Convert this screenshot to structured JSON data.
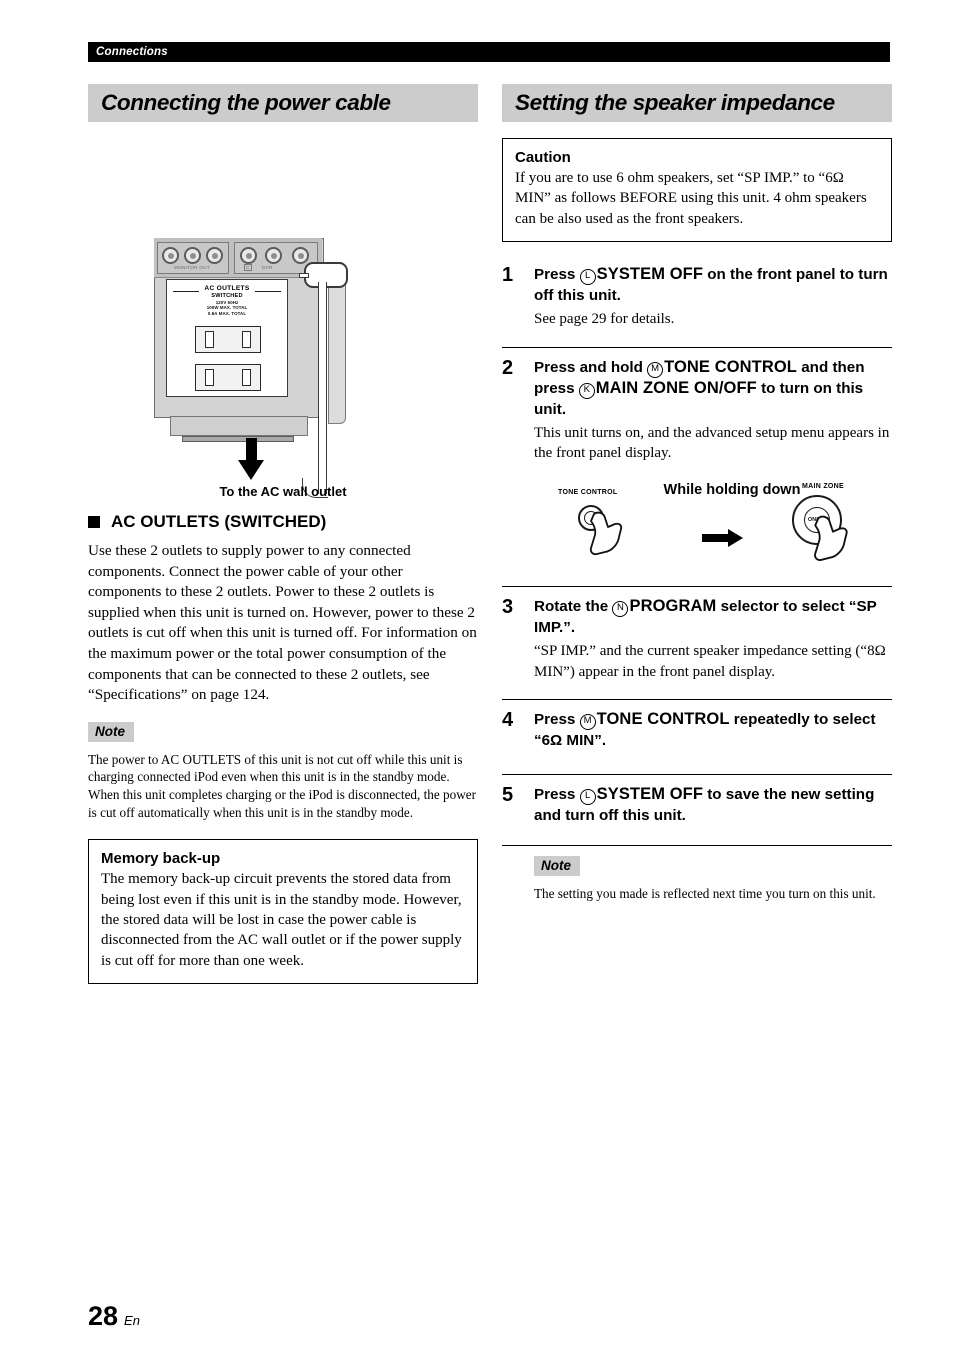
{
  "running_head": "Connections",
  "page": {
    "number": "28",
    "lang": "En"
  },
  "left_column": {
    "section_title": "Connecting the power cable",
    "illustration": {
      "jack_label_monitor": "MONITOR OUT",
      "jack_label_dvr": "DVR",
      "jack_label_c": "C",
      "ac_outlets_title": "AC OUTLETS",
      "ac_outlets_sub": "SWITCHED",
      "ac_outlets_spec1": "120V 60Hz",
      "ac_outlets_spec2": "100W MAX. TOTAL",
      "ac_outlets_spec3": "0.8A MAX. TOTAL",
      "caption": "To the AC wall outlet"
    },
    "subsection": {
      "heading": "AC OUTLETS (SWITCHED)",
      "body": "Use these 2 outlets to supply power to any connected components. Connect the power cable of your other components to these 2 outlets. Power to these 2 outlets is supplied when this unit is turned on. However, power to these 2 outlets is cut off when this unit is turned off. For information on the maximum power or the total power consumption of the components that can be connected to these 2 outlets, see “Specifications” on page 124."
    },
    "note": {
      "tag": "Note",
      "body": "The power to AC OUTLETS of this unit is not cut off while this unit is charging connected iPod even when this unit is in the standby mode. When this unit completes charging or the iPod is disconnected, the power is cut off automatically when this unit is in the standby mode."
    },
    "memory_box": {
      "heading": "Memory back-up",
      "body": "The memory back-up circuit prevents the stored data from being lost even if this unit is in the standby mode. However, the stored data will be lost in case the power cable is disconnected from the AC wall outlet or if the power supply is cut off for more than one week."
    }
  },
  "right_column": {
    "section_title": "Setting the speaker impedance",
    "caution": {
      "heading": "Caution",
      "body": "If you are to use 6 ohm speakers, set “SP IMP.” to “6Ω MIN” as follows BEFORE using this unit. 4 ohm speakers can be also used as the front speakers."
    },
    "steps": [
      {
        "num": "1",
        "title_pre": "Press ",
        "key_letter": "L",
        "key_label": "SYSTEM OFF",
        "title_post": " on the front panel to turn off this unit.",
        "desc": "See page 29 for details."
      },
      {
        "num": "2",
        "title_pre": "Press and hold ",
        "key_letter": "M",
        "key_label": "TONE CONTROL",
        "title_mid": " and then press ",
        "key_letter2": "K",
        "key_label2": "MAIN ZONE ON/OFF",
        "title_post": " to turn on this unit.",
        "desc": "This unit turns on, and the advanced setup menu appears in the front panel display."
      },
      {
        "num": "3",
        "title_pre": "Rotate the ",
        "key_letter": "N",
        "key_label": "PROGRAM",
        "title_post": " selector to select “SP IMP.”.",
        "desc": "“SP IMP.” and the current speaker impedance setting (“8Ω MIN”) appear in the front panel display."
      },
      {
        "num": "4",
        "title_pre": "Press ",
        "key_letter": "M",
        "key_label": "TONE CONTROL",
        "title_post": " repeatedly to select “6Ω MIN”.",
        "desc": ""
      },
      {
        "num": "5",
        "title_pre": "Press ",
        "key_letter": "L",
        "key_label": "SYSTEM OFF",
        "title_post": " to save the new setting and turn off this unit.",
        "desc": ""
      }
    ],
    "knob_figure": {
      "left_label": "TONE CONTROL",
      "hold_text": "While holding down",
      "right_label": "MAIN ZONE",
      "right_knob_text": "ON/OFF"
    },
    "note": {
      "tag": "Note",
      "body": "The setting you made is reflected next time you turn on this unit."
    }
  }
}
